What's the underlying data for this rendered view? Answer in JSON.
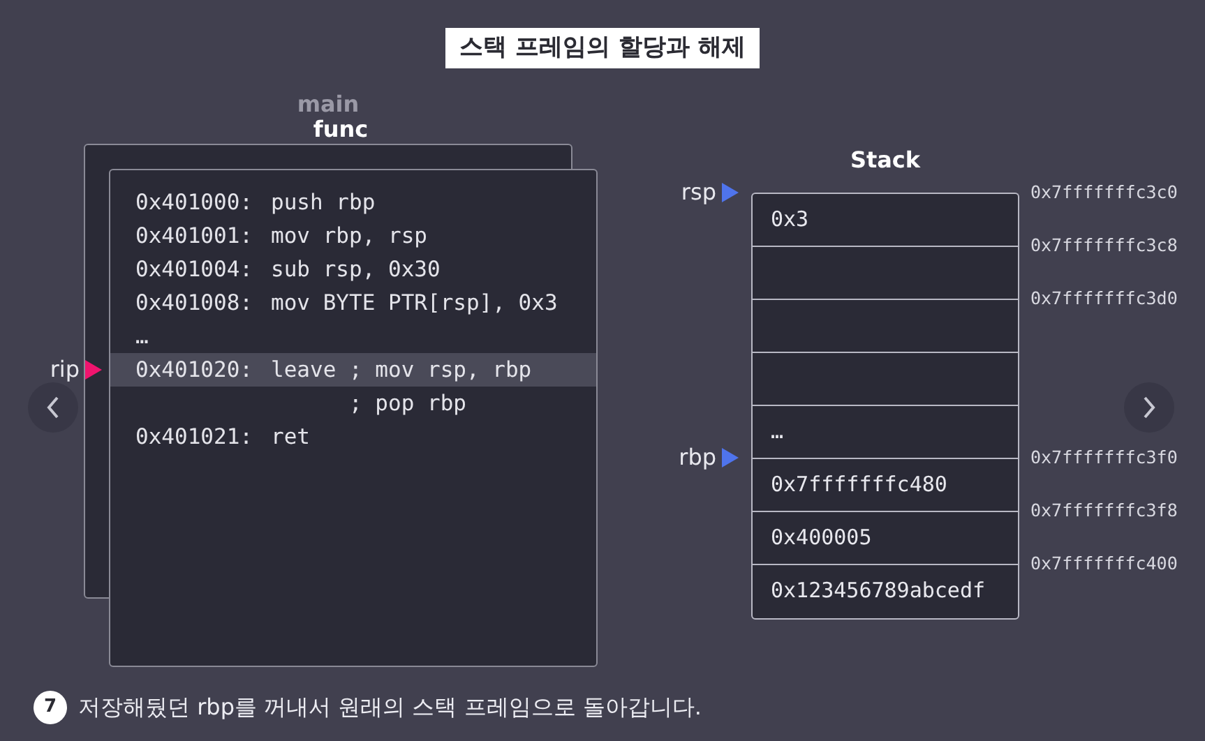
{
  "title": "스택 프레임의 할당과 해제",
  "frames": {
    "outer_label": "main",
    "inner_label": "func"
  },
  "code": {
    "pointer": {
      "label": "rip",
      "color": "#f0146e"
    },
    "lines": [
      {
        "address": "0x401000:",
        "instruction": "push rbp",
        "current": false
      },
      {
        "address": "0x401001:",
        "instruction": "mov rbp, rsp",
        "current": false
      },
      {
        "address": "0x401004:",
        "instruction": "sub rsp, 0x30",
        "current": false
      },
      {
        "address": "0x401008:",
        "instruction": "mov BYTE PTR[rsp], 0x3",
        "current": false
      },
      {
        "address": "…",
        "current": false
      },
      {
        "address": "0x401020:",
        "instruction": "leave ; mov rsp, rbp",
        "current": true
      },
      {
        "instruction": "      ; pop rbp",
        "current": false
      },
      {
        "address": "0x401021:",
        "instruction": "ret",
        "current": false
      }
    ]
  },
  "stack": {
    "title": "Stack",
    "rows": [
      {
        "value": "0x3",
        "address": "0x7fffffffc3c0",
        "pointer": {
          "label": "rsp",
          "color": "#4f74ec"
        }
      },
      {
        "address": "0x7fffffffc3c8"
      },
      {
        "address": "0x7fffffffc3d0"
      },
      {},
      {
        "value": "…"
      },
      {
        "value": "0x7fffffffc480",
        "address": "0x7fffffffc3f0",
        "pointer": {
          "label": "rbp",
          "color": "#4f74ec"
        }
      },
      {
        "value": "0x400005",
        "address": "0x7fffffffc3f8"
      },
      {
        "value": "0x123456789abcedf",
        "address": "0x7fffffffc400"
      }
    ]
  },
  "caption": {
    "step": "7",
    "text": "저장해뒀던 rbp를 꺼내서 원래의 스택 프레임으로 돌아갑니다."
  }
}
